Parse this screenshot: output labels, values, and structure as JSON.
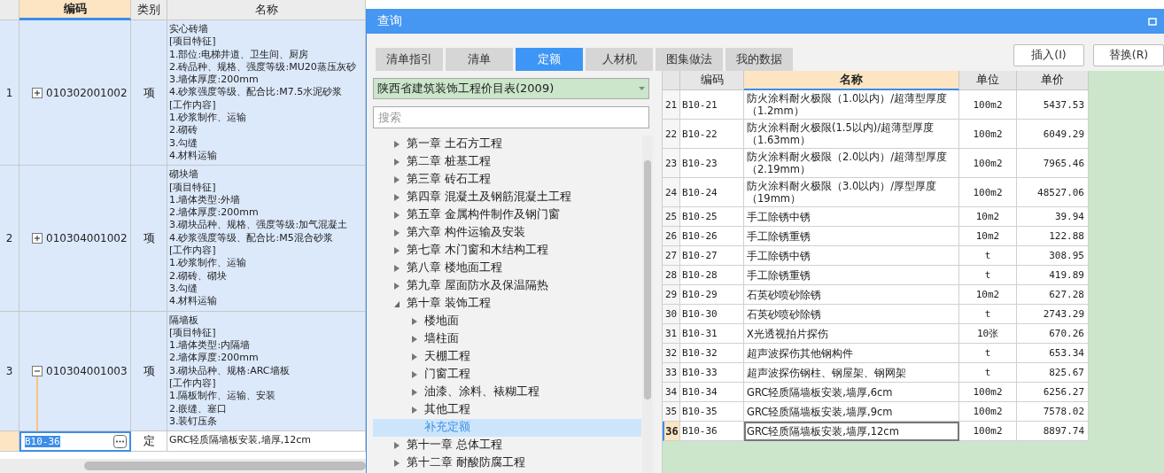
{
  "grid": {
    "columns": [
      {
        "label": "编码",
        "selected": true
      },
      {
        "label": "类别",
        "selected": false
      },
      {
        "label": "名称",
        "selected": false
      }
    ],
    "rows": [
      {
        "index": "1",
        "code": "010302001002",
        "kind": "parent",
        "expanded": false,
        "selected": true,
        "current": false,
        "type": "项",
        "name": [
          "实心砖墙",
          "[项目特征]",
          "1.部位:电梯井道、卫生间、厨房",
          "2.砖品种、规格、强度等级:MU20蒸压灰砂",
          "3.墙体厚度:200mm",
          "4.砂浆强度等级、配合比:M7.5水泥砂浆",
          "[工作内容]",
          "1.砂浆制作、运输",
          "2.砌砖",
          "3.勾缝",
          "4.材料运输"
        ]
      },
      {
        "index": "2",
        "code": "010304001002",
        "kind": "parent",
        "expanded": false,
        "selected": true,
        "current": false,
        "type": "项",
        "name": [
          "砌块墙",
          "[项目特征]",
          "1.墙体类型:外墙",
          "2.墙体厚度:200mm",
          "3.砌块品种、规格、强度等级:加气混凝土",
          "4.砂浆强度等级、配合比:M5混合砂浆",
          "[工作内容]",
          "1.砂浆制作、运输",
          "2.砌砖、砌块",
          "3.勾缝",
          "4.材料运输"
        ]
      },
      {
        "index": "3",
        "code": "010304001003",
        "kind": "parent",
        "expanded": true,
        "selected": true,
        "current": false,
        "type": "项",
        "name": [
          "隔墙板",
          "[项目特征]",
          "1.墙体类型:内隔墙",
          "2.墙体厚度:200mm",
          "3.砌块品种、规格:ARC墙板",
          "[工作内容]",
          "1.隔板制作、运输、安装",
          "2.嵌缝、塞口",
          "3.装钉压条"
        ]
      },
      {
        "index": "",
        "code": "B10-36",
        "kind": "editor",
        "selected": false,
        "current": true,
        "type": "定",
        "name": [
          "GRC轻质隔墙板安装,墙厚,12cm"
        ]
      }
    ]
  },
  "dialog": {
    "title": "查询",
    "tabs": [
      {
        "label": "清单指引",
        "selected": false
      },
      {
        "label": "清单",
        "selected": false
      },
      {
        "label": "定额",
        "selected": true
      },
      {
        "label": "人材机",
        "selected": false
      },
      {
        "label": "图集做法",
        "selected": false
      },
      {
        "label": "我的数据",
        "selected": false
      }
    ],
    "buttons": [
      "插入(I)",
      "替换(R)"
    ],
    "library": "陕西省建筑装饰工程价目表(2009)",
    "search": {
      "placeholder": "搜索"
    },
    "tree": [
      {
        "label": "第一章 土石方工程",
        "kind": "folder",
        "expanded": false,
        "selected": false
      },
      {
        "label": "第二章 桩基工程",
        "kind": "folder",
        "expanded": false,
        "selected": false
      },
      {
        "label": "第三章 砖石工程",
        "kind": "folder",
        "expanded": false,
        "selected": false
      },
      {
        "label": "第四章 混凝土及钢筋混凝土工程",
        "kind": "folder",
        "expanded": false,
        "selected": false
      },
      {
        "label": "第五章 金属构件制作及钢门窗",
        "kind": "folder",
        "expanded": false,
        "selected": false
      },
      {
        "label": "第六章 构件运输及安装",
        "kind": "folder",
        "expanded": false,
        "selected": false
      },
      {
        "label": "第七章 木门窗和木结构工程",
        "kind": "folder",
        "expanded": false,
        "selected": false
      },
      {
        "label": "第八章 楼地面工程",
        "kind": "folder",
        "expanded": false,
        "selected": false
      },
      {
        "label": "第九章 屋面防水及保温隔热",
        "kind": "folder",
        "expanded": false,
        "selected": false
      },
      {
        "label": "第十章 装饰工程",
        "kind": "folder",
        "expanded": true,
        "selected": false,
        "children": [
          {
            "label": "楼地面",
            "kind": "folder",
            "expanded": false,
            "selected": false
          },
          {
            "label": "墙柱面",
            "kind": "folder",
            "expanded": false,
            "selected": false
          },
          {
            "label": "天棚工程",
            "kind": "folder",
            "expanded": false,
            "selected": false
          },
          {
            "label": "门窗工程",
            "kind": "folder",
            "expanded": false,
            "selected": false
          },
          {
            "label": "油漆、涂料、裱糊工程",
            "kind": "folder",
            "expanded": false,
            "selected": false
          },
          {
            "label": "其他工程",
            "kind": "folder",
            "expanded": false,
            "selected": false
          },
          {
            "label": "补充定额",
            "kind": "leaf",
            "selected": true
          }
        ]
      },
      {
        "label": "第十一章 总体工程",
        "kind": "folder",
        "expanded": false,
        "selected": false
      },
      {
        "label": "第十二章 耐酸防腐工程",
        "kind": "folder",
        "expanded": false,
        "selected": false
      }
    ],
    "table": {
      "columns": [
        {
          "label": "编码",
          "selected": false
        },
        {
          "label": "名称",
          "selected": true
        },
        {
          "label": "单位",
          "selected": false
        },
        {
          "label": "单价",
          "selected": false
        }
      ],
      "rows": [
        {
          "index": "21",
          "code": "B10-21",
          "name": "防火涂料耐火极限（1.0以内）/超薄型厚度（1.2mm）",
          "unit": "100m2",
          "price": "5437.53",
          "selected": false
        },
        {
          "index": "22",
          "code": "B10-22",
          "name": "防火涂料耐火极限(1.5以内)/超薄型厚度（1.63mm）",
          "unit": "100m2",
          "price": "6049.29",
          "selected": false
        },
        {
          "index": "23",
          "code": "B10-23",
          "name": "防火涂料耐火极限（2.0以内）/超薄型厚度（2.19mm）",
          "unit": "100m2",
          "price": "7965.46",
          "selected": false
        },
        {
          "index": "24",
          "code": "B10-24",
          "name": "防火涂料耐火极限（3.0以内）/厚型厚度（19mm）",
          "unit": "100m2",
          "price": "48527.06",
          "selected": false
        },
        {
          "index": "25",
          "code": "B10-25",
          "name": "手工除锈中锈",
          "unit": "10m2",
          "price": "39.94",
          "selected": false
        },
        {
          "index": "26",
          "code": "B10-26",
          "name": "手工除锈重锈",
          "unit": "10m2",
          "price": "122.88",
          "selected": false
        },
        {
          "index": "27",
          "code": "B10-27",
          "name": "手工除锈中锈",
          "unit": "t",
          "price": "308.95",
          "selected": false
        },
        {
          "index": "28",
          "code": "B10-28",
          "name": "手工除锈重锈",
          "unit": "t",
          "price": "419.89",
          "selected": false
        },
        {
          "index": "29",
          "code": "B10-29",
          "name": "石英砂喷砂除锈",
          "unit": "10m2",
          "price": "627.28",
          "selected": false
        },
        {
          "index": "30",
          "code": "B10-30",
          "name": "石英砂喷砂除锈",
          "unit": "t",
          "price": "2743.29",
          "selected": false
        },
        {
          "index": "31",
          "code": "B10-31",
          "name": "X光透视拍片探伤",
          "unit": "10张",
          "price": "670.26",
          "selected": false
        },
        {
          "index": "32",
          "code": "B10-32",
          "name": "超声波探伤其他钢构件",
          "unit": "t",
          "price": "653.34",
          "selected": false
        },
        {
          "index": "33",
          "code": "B10-33",
          "name": "超声波探伤钢柱、钢屋架、钢网架",
          "unit": "t",
          "price": "825.67",
          "selected": false
        },
        {
          "index": "34",
          "code": "B10-34",
          "name": "GRC轻质隔墙板安装,墙厚,6cm",
          "unit": "100m2",
          "price": "6256.27",
          "selected": false
        },
        {
          "index": "35",
          "code": "B10-35",
          "name": "GRC轻质隔墙板安装,墙厚,9cm",
          "unit": "100m2",
          "price": "7578.02",
          "selected": false
        },
        {
          "index": "36",
          "code": "B10-36",
          "name": "GRC轻质隔墙板安装,墙厚,12cm",
          "unit": "100m2",
          "price": "8897.74",
          "selected": true
        }
      ]
    }
  }
}
